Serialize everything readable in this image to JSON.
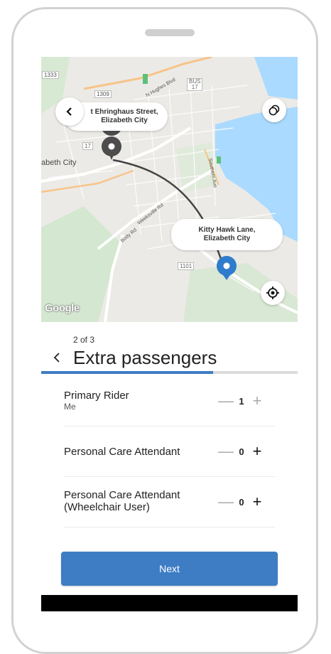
{
  "map": {
    "pickup_label": "t Ehringhaus Street,\nElizabeth City",
    "dropoff_label": "Kitty Hawk Lane,\nElizabeth City",
    "place_label": "abeth City",
    "road_1333": "1333",
    "road_1309": "1309",
    "road_1101": "1101",
    "road_bus17": "BUS\n17",
    "road_17": "17",
    "street_n_hughes": "N Hughes Blvd",
    "street_southern": "Southern Ave",
    "street_body": "Body Rd",
    "street_weeksville": "Weeksville Rd",
    "google": "Google",
    "water_color": "#aadaff",
    "park_color": "#ceead6"
  },
  "flow": {
    "step": "2 of 3",
    "title": "Extra passengers",
    "progress": 0.67
  },
  "passengers": [
    {
      "label": "Primary Rider",
      "sublabel": "Me",
      "count": "1",
      "minus_enabled": false,
      "plus_enabled": false
    },
    {
      "label": "Personal Care Attendant",
      "sublabel": "",
      "count": "0",
      "minus_enabled": false,
      "plus_enabled": true
    },
    {
      "label": "Personal Care Attendant\n(Wheelchair User)",
      "sublabel": "",
      "count": "0",
      "minus_enabled": false,
      "plus_enabled": true
    }
  ],
  "stepper": {
    "minus": "—",
    "plus": "+"
  },
  "actions": {
    "next_label": "Next"
  },
  "colors": {
    "accent": "#3e7dc4",
    "pin_pickup": "#4d4d4d",
    "pin_dropoff": "#2f7ccc"
  }
}
